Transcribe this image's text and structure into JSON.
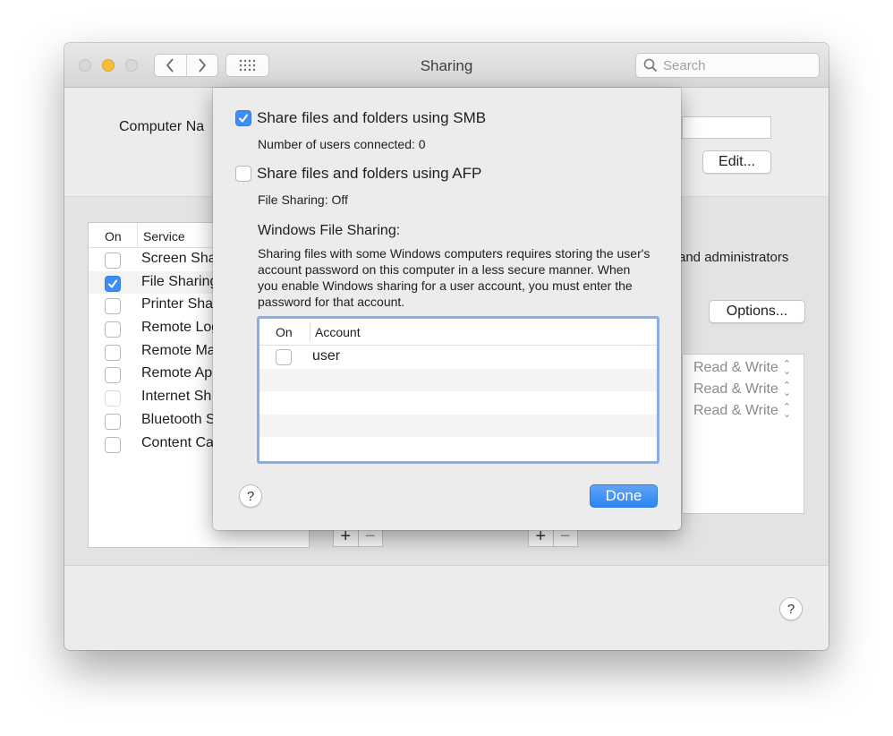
{
  "window": {
    "title": "Sharing"
  },
  "search": {
    "placeholder": "Search"
  },
  "computer_name": {
    "label": "Computer Na"
  },
  "buttons": {
    "edit": "Edit...",
    "options": "Options...",
    "done": "Done"
  },
  "services": {
    "header_on": "On",
    "header_service": "Service",
    "items": [
      {
        "label": "Screen Sha",
        "checked": false
      },
      {
        "label": "File Sharing",
        "checked": true
      },
      {
        "label": "Printer Sha",
        "checked": false
      },
      {
        "label": "Remote Log",
        "checked": false
      },
      {
        "label": "Remote Ma",
        "checked": false
      },
      {
        "label": "Remote App",
        "checked": false
      },
      {
        "label": "Internet Sh",
        "checked": false
      },
      {
        "label": "Bluetooth S",
        "checked": false
      },
      {
        "label": "Content Ca",
        "checked": false
      }
    ]
  },
  "right_panel": {
    "description_fragment": "and administrators",
    "permissions": [
      "Read & Write",
      "Read & Write",
      "Read & Write"
    ]
  },
  "pm": {
    "plus": "+",
    "minus": "−"
  },
  "help": "?",
  "sheet": {
    "smb_label": "Share files and folders using SMB",
    "smb_checked": true,
    "smb_status": "Number of users connected: 0",
    "afp_label": "Share files and folders using AFP",
    "afp_checked": false,
    "afp_status": "File Sharing: Off",
    "windows_heading": "Windows File Sharing:",
    "windows_text": "Sharing files with some Windows computers requires storing the user's account password on this computer in a less secure manner. When you enable Windows sharing for a user account, you must enter the password for that account.",
    "table": {
      "header_on": "On",
      "header_account": "Account",
      "rows": [
        {
          "account": "user",
          "checked": false
        }
      ]
    }
  },
  "colors": {
    "accent": "#3c8ef5",
    "focus_ring": "#86aee9",
    "window_bg": "#ececec"
  }
}
